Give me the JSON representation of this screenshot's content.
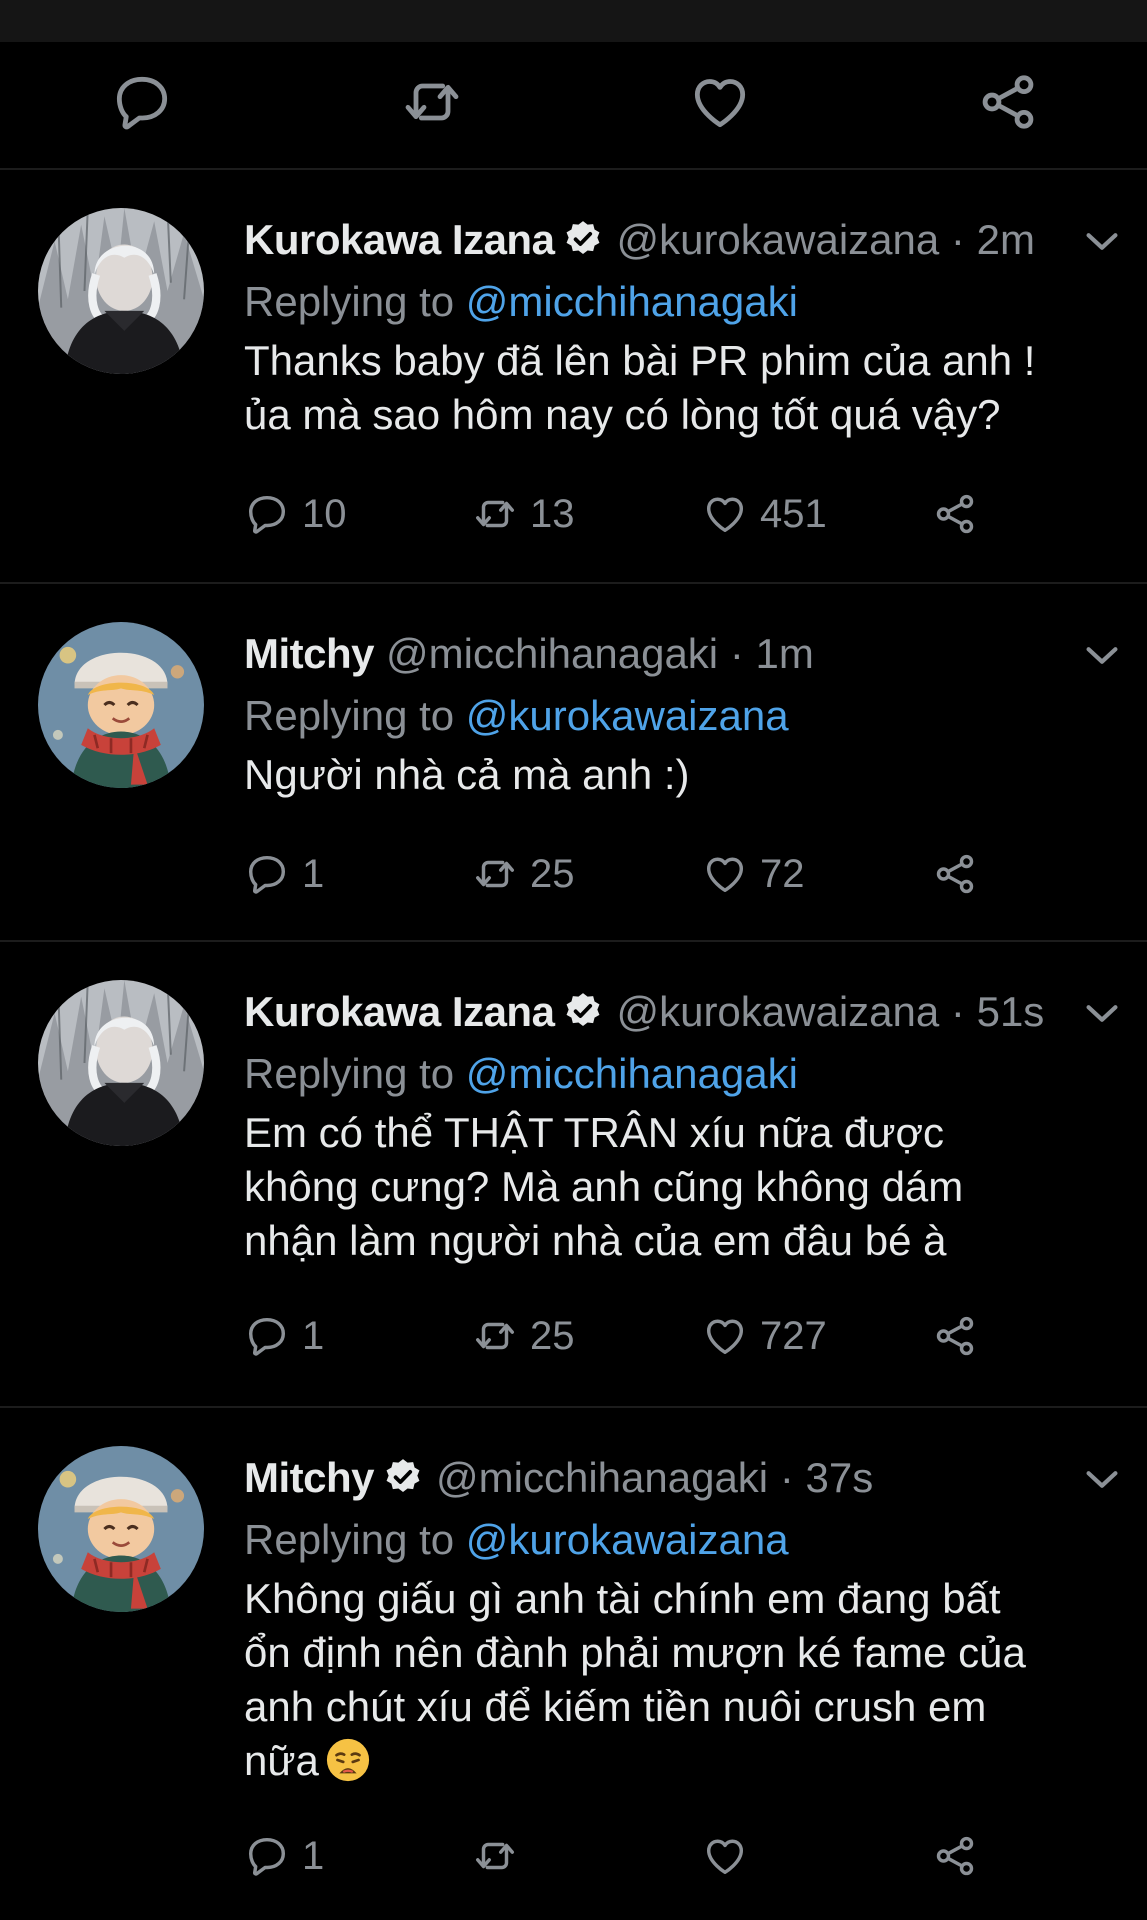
{
  "colors": {
    "background": "#000000",
    "text": "#e7e9ea",
    "muted": "#8b9096",
    "mention": "#4fa3e8",
    "divider": "#1c1c1c"
  },
  "top_actions": [
    "reply-icon",
    "retweet-icon",
    "like-icon",
    "share-icon"
  ],
  "tweets": [
    {
      "name": "Kurokawa Izana",
      "verified": true,
      "handle": "@kurokawaizana",
      "dot": "·",
      "time": "2m",
      "reply_prefix": "Replying to",
      "reply_to": "@micchihanagaki",
      "body_lines": [
        "Thanks baby đã lên bài PR phim của anh !",
        "ủa mà sao hôm nay có lòng tốt quá vậy?"
      ],
      "replies": "10",
      "retweets": "13",
      "likes": "451"
    },
    {
      "name": "Mitchy",
      "verified": false,
      "handle": "@micchihanagaki",
      "dot": "·",
      "time": "1m",
      "reply_prefix": "Replying to",
      "reply_to": "@kurokawaizana",
      "body_lines": [
        "Người nhà cả mà anh :)"
      ],
      "replies": "1",
      "retweets": "25",
      "likes": "72"
    },
    {
      "name": "Kurokawa Izana",
      "verified": true,
      "handle": "@kurokawaizana",
      "dot": "·",
      "time": "51s",
      "reply_prefix": "Replying to",
      "reply_to": "@micchihanagaki",
      "body_lines": [
        "Em có thể THẬT TRÂN xíu nữa được",
        "không cưng? Mà anh cũng không dám",
        "nhận làm người nhà của em đâu bé à"
      ],
      "replies": "1",
      "retweets": "25",
      "likes": "727"
    },
    {
      "name": "Mitchy",
      "verified": true,
      "handle": "@micchihanagaki",
      "dot": "·",
      "time": "37s",
      "reply_prefix": "Replying to",
      "reply_to": "@kurokawaizana",
      "body_lines": [
        "Không giấu gì anh tài chính em đang bất",
        "ổn định nên đành phải mượn ké fame của",
        "anh chút xíu để kiếm tiền nuôi crush em",
        "nữa"
      ],
      "body_emoji": "weary-face-emoji",
      "replies": "1",
      "retweets": "",
      "likes": ""
    }
  ]
}
